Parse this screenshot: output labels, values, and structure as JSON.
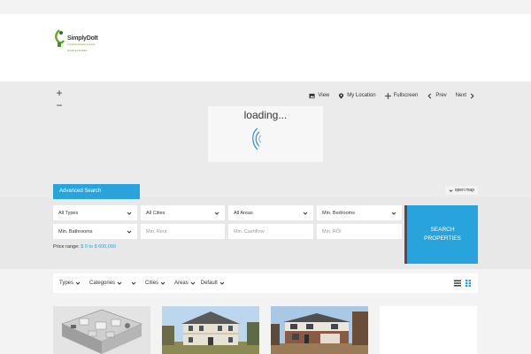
{
  "logo": {
    "name": "SimplyDoIt",
    "tagline": "Trusted Real Estate Investing",
    "sub": "Investment Portfolio"
  },
  "map": {
    "zoom_in": "+",
    "zoom_out": "−",
    "controls": {
      "view": "View",
      "location": "My Location",
      "fullscreen": "Fullscreen",
      "prev": "Prev",
      "next": "Next"
    },
    "loading": "loading..."
  },
  "search": {
    "tab": "Advanced Search",
    "open_map": "open map",
    "types": "All Types",
    "cities": "All Cities",
    "areas": "All Areas",
    "bedrooms": "Min. Bedrooms",
    "bathrooms": "Min. Bathrooms",
    "rent_placeholder": "Min. Rent",
    "cashflow_placeholder": "Min. Cashflow",
    "roi_placeholder": "Min. ROI",
    "price_label": "Price range:",
    "price_value": "$ 0 to $ 600,000",
    "button_line1": "SEARCH",
    "button_line2": "PROPERTIES"
  },
  "filters": {
    "types": "Types",
    "categories": "Categories",
    "cities": "Cities",
    "areas": "Areas",
    "sort": "Default"
  },
  "colors": {
    "accent": "#29a3dc",
    "button_border": "#7a3b3b"
  }
}
